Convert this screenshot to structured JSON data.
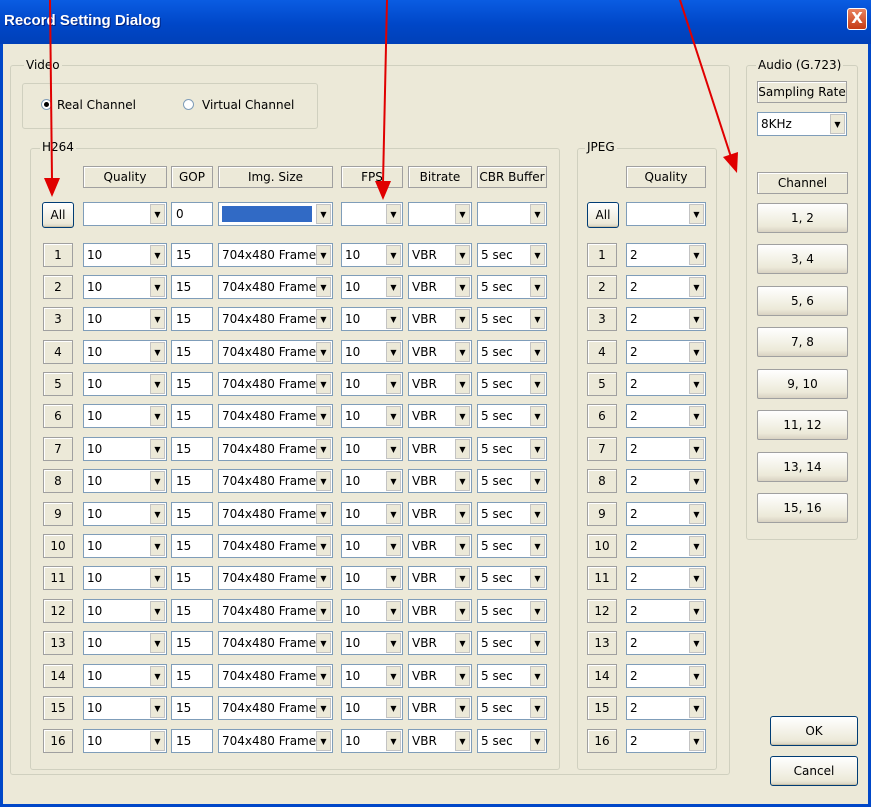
{
  "window": {
    "title": "Record Setting Dialog",
    "close_label": "X"
  },
  "video": {
    "legend": "Video",
    "real_channel_label": "Real Channel",
    "virtual_channel_label": "Virtual Channel",
    "selected_mode": "Real Channel"
  },
  "h264": {
    "legend": "H264",
    "headers": {
      "quality": "Quality",
      "gop": "GOP",
      "img_size": "Img. Size",
      "fps": "FPS",
      "bitrate": "Bitrate",
      "cbr_buffer": "CBR Buffer"
    },
    "all_label": "All",
    "all_gop": "0",
    "rows": [
      {
        "ch": "1",
        "quality": "10",
        "gop": "15",
        "img_size": "704x480 Frame",
        "fps": "10",
        "bitrate": "VBR",
        "cbr": "5 sec"
      },
      {
        "ch": "2",
        "quality": "10",
        "gop": "15",
        "img_size": "704x480 Frame",
        "fps": "10",
        "bitrate": "VBR",
        "cbr": "5 sec"
      },
      {
        "ch": "3",
        "quality": "10",
        "gop": "15",
        "img_size": "704x480 Frame",
        "fps": "10",
        "bitrate": "VBR",
        "cbr": "5 sec"
      },
      {
        "ch": "4",
        "quality": "10",
        "gop": "15",
        "img_size": "704x480 Frame",
        "fps": "10",
        "bitrate": "VBR",
        "cbr": "5 sec"
      },
      {
        "ch": "5",
        "quality": "10",
        "gop": "15",
        "img_size": "704x480 Frame",
        "fps": "10",
        "bitrate": "VBR",
        "cbr": "5 sec"
      },
      {
        "ch": "6",
        "quality": "10",
        "gop": "15",
        "img_size": "704x480 Frame",
        "fps": "10",
        "bitrate": "VBR",
        "cbr": "5 sec"
      },
      {
        "ch": "7",
        "quality": "10",
        "gop": "15",
        "img_size": "704x480 Frame",
        "fps": "10",
        "bitrate": "VBR",
        "cbr": "5 sec"
      },
      {
        "ch": "8",
        "quality": "10",
        "gop": "15",
        "img_size": "704x480 Frame",
        "fps": "10",
        "bitrate": "VBR",
        "cbr": "5 sec"
      },
      {
        "ch": "9",
        "quality": "10",
        "gop": "15",
        "img_size": "704x480 Frame",
        "fps": "10",
        "bitrate": "VBR",
        "cbr": "5 sec"
      },
      {
        "ch": "10",
        "quality": "10",
        "gop": "15",
        "img_size": "704x480 Frame",
        "fps": "10",
        "bitrate": "VBR",
        "cbr": "5 sec"
      },
      {
        "ch": "11",
        "quality": "10",
        "gop": "15",
        "img_size": "704x480 Frame",
        "fps": "10",
        "bitrate": "VBR",
        "cbr": "5 sec"
      },
      {
        "ch": "12",
        "quality": "10",
        "gop": "15",
        "img_size": "704x480 Frame",
        "fps": "10",
        "bitrate": "VBR",
        "cbr": "5 sec"
      },
      {
        "ch": "13",
        "quality": "10",
        "gop": "15",
        "img_size": "704x480 Frame",
        "fps": "10",
        "bitrate": "VBR",
        "cbr": "5 sec"
      },
      {
        "ch": "14",
        "quality": "10",
        "gop": "15",
        "img_size": "704x480 Frame",
        "fps": "10",
        "bitrate": "VBR",
        "cbr": "5 sec"
      },
      {
        "ch": "15",
        "quality": "10",
        "gop": "15",
        "img_size": "704x480 Frame",
        "fps": "10",
        "bitrate": "VBR",
        "cbr": "5 sec"
      },
      {
        "ch": "16",
        "quality": "10",
        "gop": "15",
        "img_size": "704x480 Frame",
        "fps": "10",
        "bitrate": "VBR",
        "cbr": "5 sec"
      }
    ]
  },
  "jpeg": {
    "legend": "JPEG",
    "header": "Quality",
    "all_label": "All",
    "rows": [
      {
        "ch": "1",
        "quality": "2"
      },
      {
        "ch": "2",
        "quality": "2"
      },
      {
        "ch": "3",
        "quality": "2"
      },
      {
        "ch": "4",
        "quality": "2"
      },
      {
        "ch": "5",
        "quality": "2"
      },
      {
        "ch": "6",
        "quality": "2"
      },
      {
        "ch": "7",
        "quality": "2"
      },
      {
        "ch": "8",
        "quality": "2"
      },
      {
        "ch": "9",
        "quality": "2"
      },
      {
        "ch": "10",
        "quality": "2"
      },
      {
        "ch": "11",
        "quality": "2"
      },
      {
        "ch": "12",
        "quality": "2"
      },
      {
        "ch": "13",
        "quality": "2"
      },
      {
        "ch": "14",
        "quality": "2"
      },
      {
        "ch": "15",
        "quality": "2"
      },
      {
        "ch": "16",
        "quality": "2"
      }
    ]
  },
  "audio": {
    "legend": "Audio (G.723)",
    "sampling_label": "Sampling Rate",
    "sampling_value": "8KHz",
    "channel_header": "Channel",
    "channels": [
      "1, 2",
      "3, 4",
      "5, 6",
      "7, 8",
      "9, 10",
      "11, 12",
      "13, 14",
      "15, 16"
    ]
  },
  "buttons": {
    "ok": "OK",
    "cancel": "Cancel"
  },
  "colors": {
    "title_bar": "#0047c8",
    "annotation_arrow": "#e00000",
    "selection": "#316ac5"
  }
}
